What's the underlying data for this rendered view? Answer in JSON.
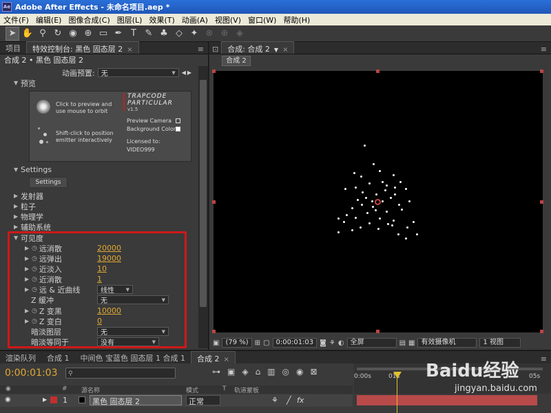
{
  "window": {
    "title": "Adobe After Effects - 未命名项目.aep *",
    "app_icon": "Ae"
  },
  "menubar": [
    "文件(F)",
    "编辑(E)",
    "图像合成(C)",
    "图层(L)",
    "效果(T)",
    "动画(A)",
    "视图(V)",
    "窗口(W)",
    "帮助(H)"
  ],
  "toolbar_icons": [
    "selection-tool",
    "hand-tool",
    "zoom-tool",
    "rotate-tool",
    "orbit-camera-tool",
    "pan-behind-tool",
    "rectangle-mask-tool",
    "pen-tool",
    "type-tool",
    "brush-tool",
    "clone-stamp-tool",
    "eraser-tool",
    "puppet-pin-tool"
  ],
  "left_panel": {
    "tabs": [
      {
        "label": "项目",
        "active": false
      },
      {
        "label": "特效控制台: 黑色 固态层 2",
        "active": true
      }
    ],
    "breadcrumb": "合成 2 • 黑色 固态层 2",
    "animation_preset_label": "动画预置:",
    "animation_preset_value": "无",
    "preview_section": "预览",
    "preview_box": {
      "click_hint": "Click to preview and\nuse mouse to orbit",
      "shift_hint": "Shift-click to position\nemitter interactively",
      "logo_line1": "TRAPCODE",
      "logo_line2": "PARTICULAR",
      "version": "v1.5",
      "preview_camera": "Preview Camera",
      "background_color": "Background Color",
      "licensed_to_label": "Licensed to:",
      "licensed_to": "VIDEO999"
    },
    "settings_section": "Settings",
    "settings_button": "Settings",
    "groups": [
      "发射器",
      "粒子",
      "物理学",
      "辅助系统"
    ],
    "visibility": {
      "label": "可见度",
      "params": [
        {
          "name": "远消散",
          "value": "20000",
          "type": "number"
        },
        {
          "name": "远弹出",
          "value": "19000",
          "type": "number"
        },
        {
          "name": "近淡入",
          "value": "10",
          "type": "number"
        },
        {
          "name": "近消散",
          "value": "1",
          "type": "number"
        },
        {
          "name": "远 & 近曲线",
          "value": "线性",
          "type": "dropdown"
        },
        {
          "name": "Z 缓冲",
          "value": "无",
          "type": "dropdown"
        },
        {
          "name": "Z 变黑",
          "value": "10000",
          "type": "number"
        },
        {
          "name": "Z 变白",
          "value": "0",
          "type": "number"
        },
        {
          "name": "暗淡图层",
          "value": "无",
          "type": "dropdown"
        },
        {
          "name": "暗淡等同于",
          "value": "没有",
          "type": "dropdown"
        }
      ]
    }
  },
  "viewer": {
    "tab": "合成: 合成 2",
    "subtab": "合成 2",
    "zoom": "(79 %)",
    "timecode": "0:00:01:03",
    "resolution": "全屏",
    "camera": "有效摄像机",
    "views": "1 视图"
  },
  "timeline": {
    "tabs": [
      {
        "label": "渲染队列",
        "active": false
      },
      {
        "label": "合成 1",
        "active": false
      },
      {
        "label": "中间色 宝蓝色 固态层 1 合成 1",
        "active": false
      },
      {
        "label": "合成 2",
        "active": true
      }
    ],
    "timecode": "0:00:01:03",
    "columns": {
      "source_name": "源名称",
      "mode": "模式",
      "t": "T",
      "track_matte": "轨道蒙板"
    },
    "ruler": [
      "0:00s",
      "01s",
      "05s"
    ],
    "layer": {
      "index": "1",
      "name": "黑色 固态层 2",
      "mode": "正常"
    }
  },
  "watermark": {
    "brand": "Baidu经验",
    "url": "jingyan.baidu.com"
  },
  "colors": {
    "timecode": "#e0a833",
    "highlight": "#d01818",
    "title_bar": "#2a6fd8",
    "layer_bar": "#b84a4a"
  }
}
